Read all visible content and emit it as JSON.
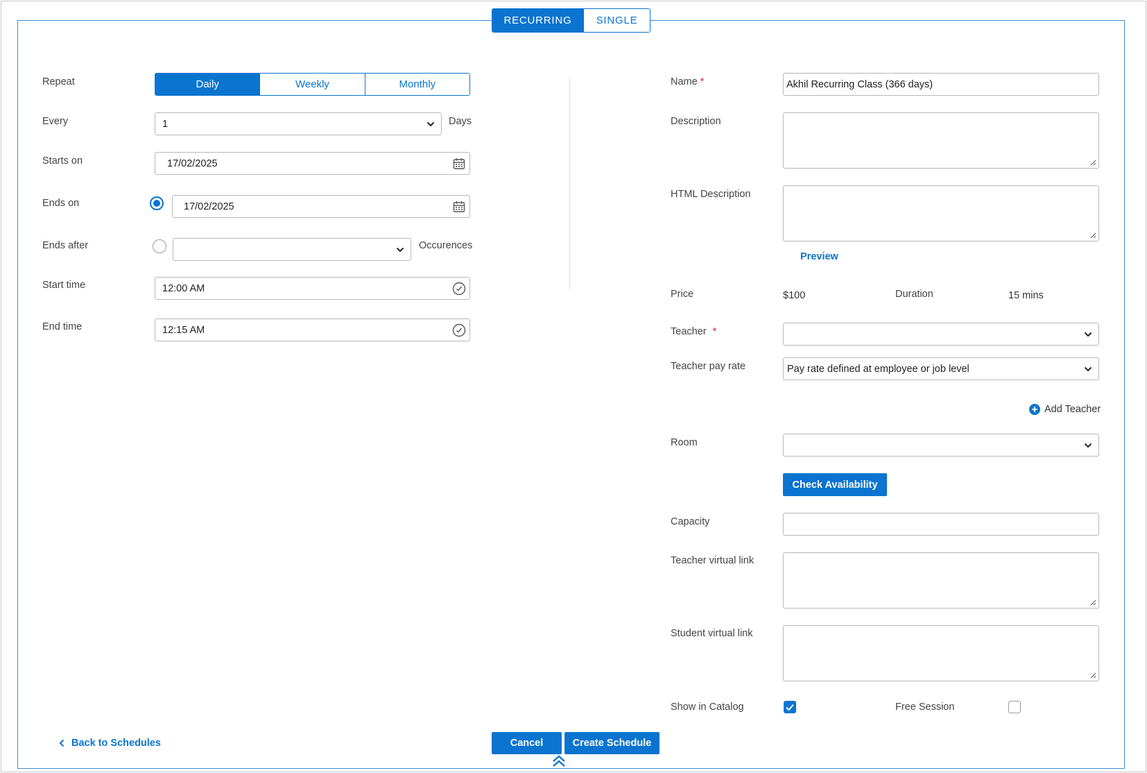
{
  "mode_tabs": {
    "recurring": "RECURRING",
    "single": "SINGLE",
    "active": "recurring"
  },
  "left": {
    "repeat": {
      "label": "Repeat",
      "options": [
        "Daily",
        "Weekly",
        "Monthly"
      ],
      "selected": "Daily"
    },
    "every": {
      "label": "Every",
      "value": "1",
      "unit": "Days"
    },
    "starts_on": {
      "label": "Starts on",
      "value": "17/02/2025"
    },
    "ends_on": {
      "label": "Ends on",
      "value": "17/02/2025",
      "selected": true
    },
    "ends_after": {
      "label": "Ends after",
      "value": "",
      "unit": "Occurences",
      "selected": false
    },
    "start_time": {
      "label": "Start time",
      "value": "12:00 AM"
    },
    "end_time": {
      "label": "End time",
      "value": "12:15 AM"
    }
  },
  "right": {
    "name": {
      "label": "Name",
      "required_mark": "*",
      "value": "Akhil Recurring Class (366 days)"
    },
    "description": {
      "label": "Description",
      "value": ""
    },
    "html_description": {
      "label": "HTML Description",
      "value": "",
      "preview_label": "Preview"
    },
    "price": {
      "label": "Price",
      "value": "$100"
    },
    "duration": {
      "label": "Duration",
      "value": "15 mins"
    },
    "teacher": {
      "label": "Teacher",
      "required_mark": "*",
      "value": ""
    },
    "teacher_pay_rate": {
      "label": "Teacher pay rate",
      "value": "Pay rate defined at employee or job level"
    },
    "add_teacher_label": "Add Teacher",
    "room": {
      "label": "Room",
      "value": ""
    },
    "check_availability_label": "Check Availability",
    "capacity": {
      "label": "Capacity",
      "value": ""
    },
    "teacher_virtual_link": {
      "label": "Teacher virtual link",
      "value": ""
    },
    "student_virtual_link": {
      "label": "Student virtual link",
      "value": ""
    },
    "show_in_catalog": {
      "label": "Show in Catalog",
      "checked": true
    },
    "free_session": {
      "label": "Free Session",
      "checked": false
    }
  },
  "footer": {
    "back_label": "Back to Schedules",
    "cancel_label": "Cancel",
    "create_label": "Create Schedule"
  },
  "colors": {
    "accent": "#0a74d0",
    "required": "#d9242b",
    "border": "#b8b8b8"
  }
}
